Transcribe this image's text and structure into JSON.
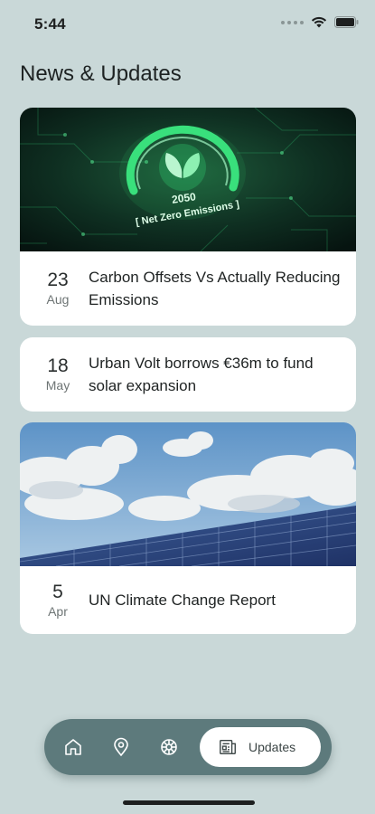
{
  "status_bar": {
    "time": "5:44"
  },
  "page": {
    "title": "News & Updates"
  },
  "news": [
    {
      "day": "23",
      "month": "Aug",
      "title": "Carbon Offsets Vs Actually Reducing Emissions",
      "image_text_year": "2050",
      "image_text_label": "[ Net Zero Emissions ]"
    },
    {
      "day": "18",
      "month": "May",
      "title": "Urban Volt borrows €36m to fund solar expansion"
    },
    {
      "day": "5",
      "month": "Apr",
      "title": "UN Climate Change Report"
    }
  ],
  "nav": {
    "items": [
      "home-icon",
      "location-pin-icon",
      "ship-wheel-icon",
      "newspaper-icon"
    ],
    "active_label": "Updates"
  },
  "colors": {
    "background": "#c9d8d8",
    "nav": "#5d7a7c",
    "card": "#ffffff"
  }
}
